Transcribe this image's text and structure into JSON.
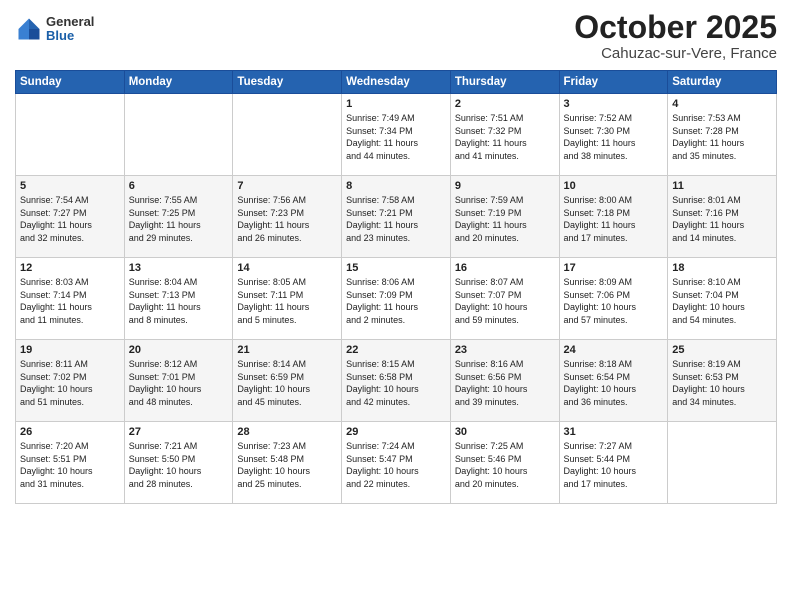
{
  "header": {
    "logo_general": "General",
    "logo_blue": "Blue",
    "month_title": "October 2025",
    "location": "Cahuzac-sur-Vere, France"
  },
  "days_of_week": [
    "Sunday",
    "Monday",
    "Tuesday",
    "Wednesday",
    "Thursday",
    "Friday",
    "Saturday"
  ],
  "weeks": [
    [
      {
        "day": "",
        "info": ""
      },
      {
        "day": "",
        "info": ""
      },
      {
        "day": "",
        "info": ""
      },
      {
        "day": "1",
        "info": "Sunrise: 7:49 AM\nSunset: 7:34 PM\nDaylight: 11 hours\nand 44 minutes."
      },
      {
        "day": "2",
        "info": "Sunrise: 7:51 AM\nSunset: 7:32 PM\nDaylight: 11 hours\nand 41 minutes."
      },
      {
        "day": "3",
        "info": "Sunrise: 7:52 AM\nSunset: 7:30 PM\nDaylight: 11 hours\nand 38 minutes."
      },
      {
        "day": "4",
        "info": "Sunrise: 7:53 AM\nSunset: 7:28 PM\nDaylight: 11 hours\nand 35 minutes."
      }
    ],
    [
      {
        "day": "5",
        "info": "Sunrise: 7:54 AM\nSunset: 7:27 PM\nDaylight: 11 hours\nand 32 minutes."
      },
      {
        "day": "6",
        "info": "Sunrise: 7:55 AM\nSunset: 7:25 PM\nDaylight: 11 hours\nand 29 minutes."
      },
      {
        "day": "7",
        "info": "Sunrise: 7:56 AM\nSunset: 7:23 PM\nDaylight: 11 hours\nand 26 minutes."
      },
      {
        "day": "8",
        "info": "Sunrise: 7:58 AM\nSunset: 7:21 PM\nDaylight: 11 hours\nand 23 minutes."
      },
      {
        "day": "9",
        "info": "Sunrise: 7:59 AM\nSunset: 7:19 PM\nDaylight: 11 hours\nand 20 minutes."
      },
      {
        "day": "10",
        "info": "Sunrise: 8:00 AM\nSunset: 7:18 PM\nDaylight: 11 hours\nand 17 minutes."
      },
      {
        "day": "11",
        "info": "Sunrise: 8:01 AM\nSunset: 7:16 PM\nDaylight: 11 hours\nand 14 minutes."
      }
    ],
    [
      {
        "day": "12",
        "info": "Sunrise: 8:03 AM\nSunset: 7:14 PM\nDaylight: 11 hours\nand 11 minutes."
      },
      {
        "day": "13",
        "info": "Sunrise: 8:04 AM\nSunset: 7:13 PM\nDaylight: 11 hours\nand 8 minutes."
      },
      {
        "day": "14",
        "info": "Sunrise: 8:05 AM\nSunset: 7:11 PM\nDaylight: 11 hours\nand 5 minutes."
      },
      {
        "day": "15",
        "info": "Sunrise: 8:06 AM\nSunset: 7:09 PM\nDaylight: 11 hours\nand 2 minutes."
      },
      {
        "day": "16",
        "info": "Sunrise: 8:07 AM\nSunset: 7:07 PM\nDaylight: 10 hours\nand 59 minutes."
      },
      {
        "day": "17",
        "info": "Sunrise: 8:09 AM\nSunset: 7:06 PM\nDaylight: 10 hours\nand 57 minutes."
      },
      {
        "day": "18",
        "info": "Sunrise: 8:10 AM\nSunset: 7:04 PM\nDaylight: 10 hours\nand 54 minutes."
      }
    ],
    [
      {
        "day": "19",
        "info": "Sunrise: 8:11 AM\nSunset: 7:02 PM\nDaylight: 10 hours\nand 51 minutes."
      },
      {
        "day": "20",
        "info": "Sunrise: 8:12 AM\nSunset: 7:01 PM\nDaylight: 10 hours\nand 48 minutes."
      },
      {
        "day": "21",
        "info": "Sunrise: 8:14 AM\nSunset: 6:59 PM\nDaylight: 10 hours\nand 45 minutes."
      },
      {
        "day": "22",
        "info": "Sunrise: 8:15 AM\nSunset: 6:58 PM\nDaylight: 10 hours\nand 42 minutes."
      },
      {
        "day": "23",
        "info": "Sunrise: 8:16 AM\nSunset: 6:56 PM\nDaylight: 10 hours\nand 39 minutes."
      },
      {
        "day": "24",
        "info": "Sunrise: 8:18 AM\nSunset: 6:54 PM\nDaylight: 10 hours\nand 36 minutes."
      },
      {
        "day": "25",
        "info": "Sunrise: 8:19 AM\nSunset: 6:53 PM\nDaylight: 10 hours\nand 34 minutes."
      }
    ],
    [
      {
        "day": "26",
        "info": "Sunrise: 7:20 AM\nSunset: 5:51 PM\nDaylight: 10 hours\nand 31 minutes."
      },
      {
        "day": "27",
        "info": "Sunrise: 7:21 AM\nSunset: 5:50 PM\nDaylight: 10 hours\nand 28 minutes."
      },
      {
        "day": "28",
        "info": "Sunrise: 7:23 AM\nSunset: 5:48 PM\nDaylight: 10 hours\nand 25 minutes."
      },
      {
        "day": "29",
        "info": "Sunrise: 7:24 AM\nSunset: 5:47 PM\nDaylight: 10 hours\nand 22 minutes."
      },
      {
        "day": "30",
        "info": "Sunrise: 7:25 AM\nSunset: 5:46 PM\nDaylight: 10 hours\nand 20 minutes."
      },
      {
        "day": "31",
        "info": "Sunrise: 7:27 AM\nSunset: 5:44 PM\nDaylight: 10 hours\nand 17 minutes."
      },
      {
        "day": "",
        "info": ""
      }
    ]
  ]
}
